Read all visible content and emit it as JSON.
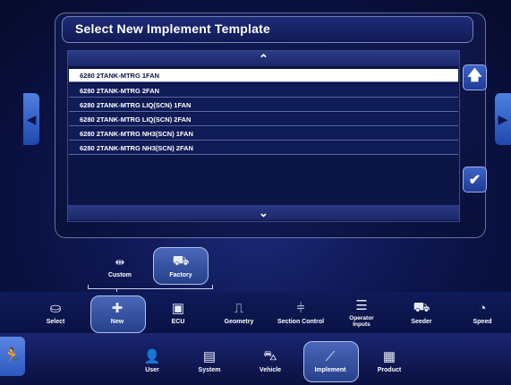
{
  "dialog": {
    "title": "Select New Implement Template",
    "items": [
      "6280 2TANK-MTRG 1FAN",
      "6280 2TANK-MTRG 2FAN",
      "6280 2TANK-MTRG LIQ(SCN) 1FAN",
      "6280 2TANK-MTRG LIQ(SCN) 2FAN",
      "6280 2TANK-MTRG NH3(SCN) 1FAN",
      "6280 2TANK-MTRG NH3(SCN) 2FAN"
    ],
    "selected_index": 0
  },
  "template_type": {
    "custom": "Custom",
    "factory": "Factory",
    "selected": "factory"
  },
  "implement_menu": {
    "items": [
      "Select",
      "New",
      "ECU",
      "Geometry",
      "Section Control",
      "Operator Inputs",
      "Seeder",
      "Speed"
    ],
    "selected": "New"
  },
  "main_menu": {
    "items": [
      "User",
      "System",
      "Vehicle",
      "Implement",
      "Product"
    ],
    "selected": "Implement"
  },
  "colors": {
    "accent": "#3e64c8",
    "background": "#0d1650",
    "selected_row": "#ffffff"
  }
}
